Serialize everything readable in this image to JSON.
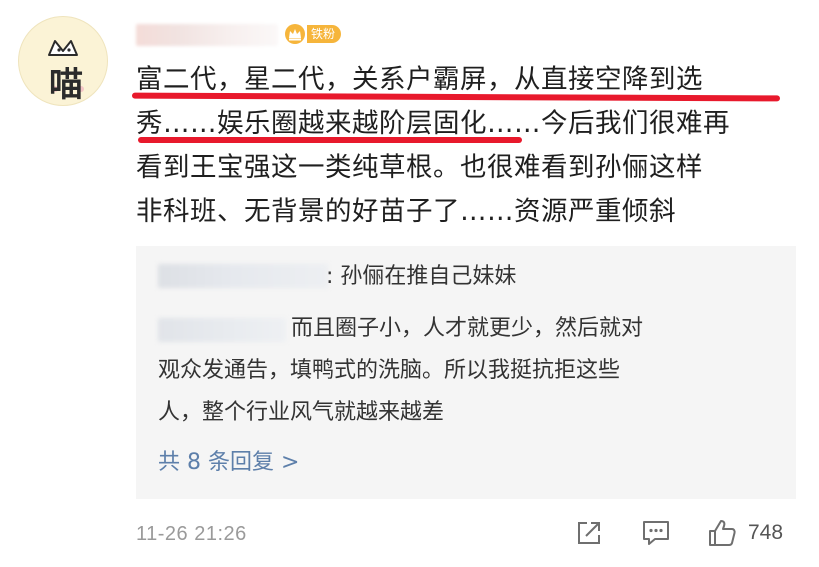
{
  "avatar": {
    "text": "喵"
  },
  "badge": {
    "label": "铁粉",
    "color": "#f6b53b"
  },
  "comment": {
    "lines": [
      "富二代，星二代，关系户霸屏，从直接空降到选",
      "秀……娱乐圈越来越阶层固化……今后我们很难再",
      "看到王宝强这一类纯草根。也很难看到孙俪这样",
      "非科班、无背景的好苗子了……资源严重倾斜"
    ],
    "highlight_color": "#e8192c"
  },
  "replies": {
    "reply1": {
      "text": ": 孙俪在推自己妹妹"
    },
    "reply2": {
      "line1": "而且圈子小，人才就更少，然后就对",
      "line2": "观众发通告，填鸭式的洗脑。所以我挺抗拒这些",
      "line3": "人，整个行业风气就越来越差"
    },
    "more_label": "共 8 条回复 >",
    "link_color": "#5d7faa"
  },
  "footer": {
    "timestamp": "11-26 21:26",
    "like_count": "748",
    "icons": [
      "share-icon",
      "comment-icon",
      "like-icon"
    ]
  }
}
